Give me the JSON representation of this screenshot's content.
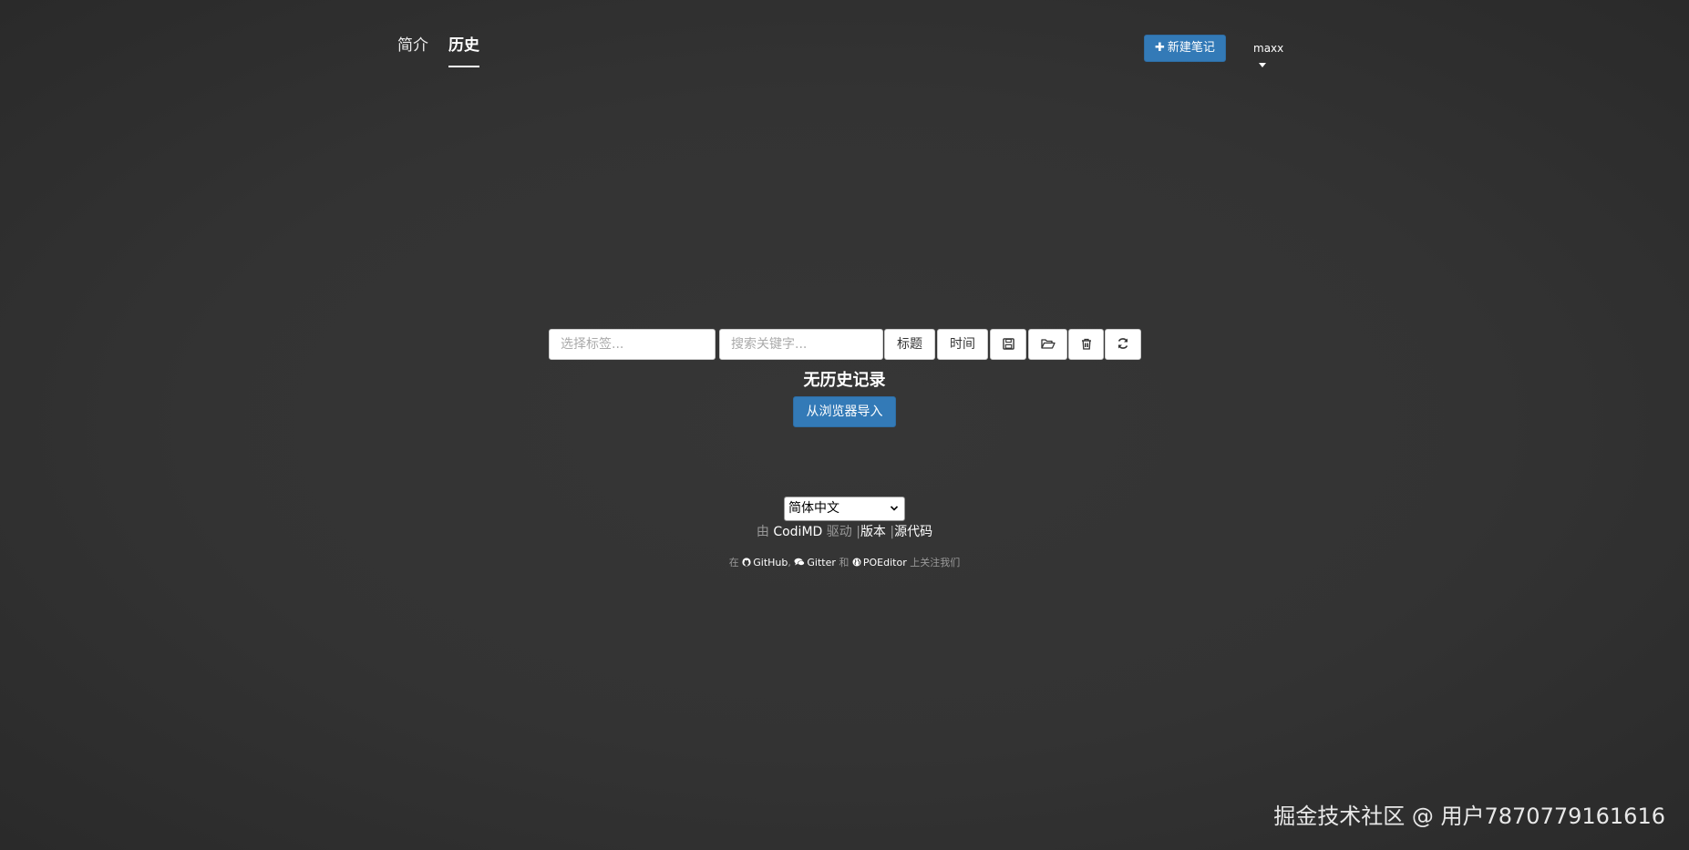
{
  "nav": {
    "tabs": [
      {
        "label": "简介",
        "active": false
      },
      {
        "label": "历史",
        "active": true
      }
    ],
    "new_note_label": "新建笔记",
    "user_name": "maxx"
  },
  "toolbar": {
    "tag_placeholder": "选择标签...",
    "search_placeholder": "搜索关键字...",
    "sort_title_label": "标题",
    "sort_time_label": "时间",
    "icons": [
      "save-icon",
      "folder-open-icon",
      "trash-icon",
      "refresh-icon"
    ]
  },
  "history": {
    "empty_text": "无历史记录",
    "import_label": "从浏览器导入"
  },
  "footer": {
    "language_selected": "简体中文",
    "powered_prefix": "由",
    "powered_name": "CodiMD",
    "powered_suffix": "驱动",
    "separator": "|",
    "version_label": "版本",
    "source_label": "源代码",
    "follow_prefix": "在",
    "github_label": "GitHub",
    "comma": ",",
    "gitter_label": "Gitter",
    "and_text": "和",
    "poeditor_label": "POEditor",
    "follow_suffix": "上关注我们"
  },
  "watermark": "掘金技术社区 @ 用户7870779161616",
  "colors": {
    "background": "#333333",
    "primary": "#337ab7",
    "muted_text": "#999999"
  }
}
